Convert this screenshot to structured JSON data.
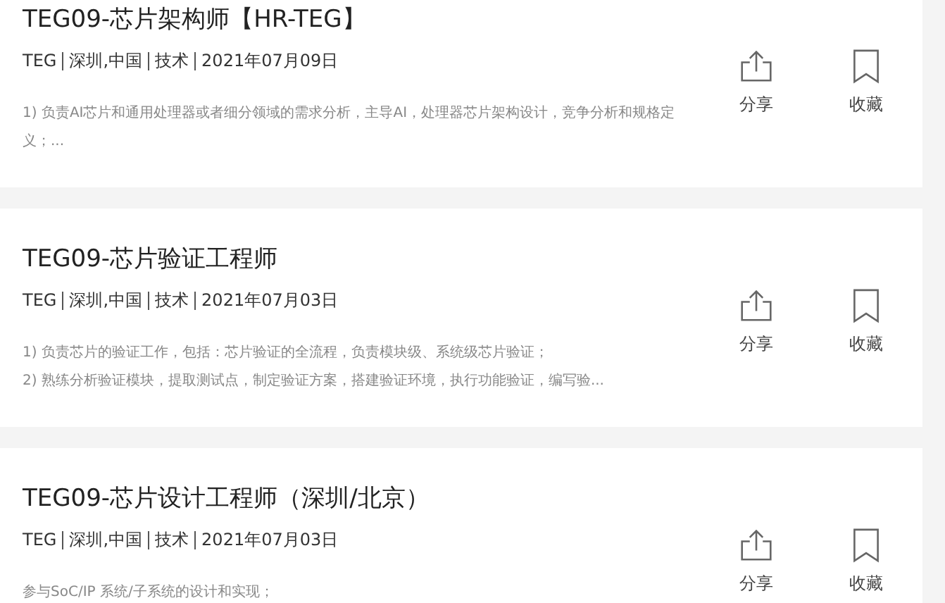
{
  "jobs": [
    {
      "title": "TEG09-芯片架构师【HR-TEG】",
      "meta": [
        "TEG",
        "深圳,中国",
        "技术",
        "2021年07月09日"
      ],
      "description": [
        "1) 负责AI芯片和通用处理器或者细分领域的需求分析，主导AI，处理器芯片架构设计，竞争分析和规格定义；..."
      ],
      "share": "分享",
      "favorite": "收藏"
    },
    {
      "title": "TEG09-芯片验证工程师",
      "meta": [
        "TEG",
        "深圳,中国",
        "技术",
        "2021年07月03日"
      ],
      "description": [
        "1) 负责芯片的验证工作，包括：芯片验证的全流程，负责模块级、系统级芯片验证；",
        "2) 熟练分析验证模块，提取测试点，制定验证方案，搭建验证环境，执行功能验证，编写验..."
      ],
      "share": "分享",
      "favorite": "收藏"
    },
    {
      "title": "TEG09-芯片设计工程师（深圳/北京）",
      "meta": [
        "TEG",
        "深圳,中国",
        "技术",
        "2021年07月03日"
      ],
      "description": [
        "参与SoC/IP 系统/子系统的设计和实现；"
      ],
      "share": "分享",
      "favorite": "收藏"
    }
  ]
}
